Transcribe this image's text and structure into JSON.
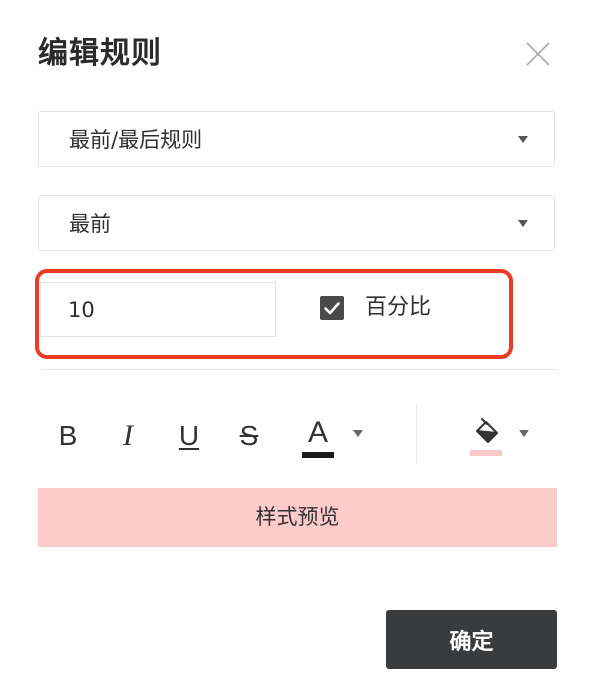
{
  "dialog": {
    "title": "编辑规则",
    "close_icon": "close-icon"
  },
  "rule_type_select": {
    "value": "最前/最后规则",
    "icon": "caret-down-icon"
  },
  "position_select": {
    "value": "最前",
    "icon": "caret-down-icon"
  },
  "count_input": {
    "value": "10"
  },
  "percent_checkbox": {
    "checked": true,
    "label": "百分比",
    "icon": "checkmark-icon"
  },
  "toolbar": {
    "bold_label": "B",
    "italic_label": "I",
    "underline_label": "U",
    "strikethrough_label": "S",
    "font_color_label": "A",
    "font_color_value": "#1a1a1a",
    "fill_icon": "paint-bucket-icon",
    "fill_color_value": "#f8c9c8"
  },
  "preview": {
    "label": "样式预览",
    "background": "#fccbca"
  },
  "footer": {
    "confirm_label": "确定"
  },
  "colors": {
    "highlight_border": "#ee3b24",
    "button_dark": "#3a3b3d"
  }
}
